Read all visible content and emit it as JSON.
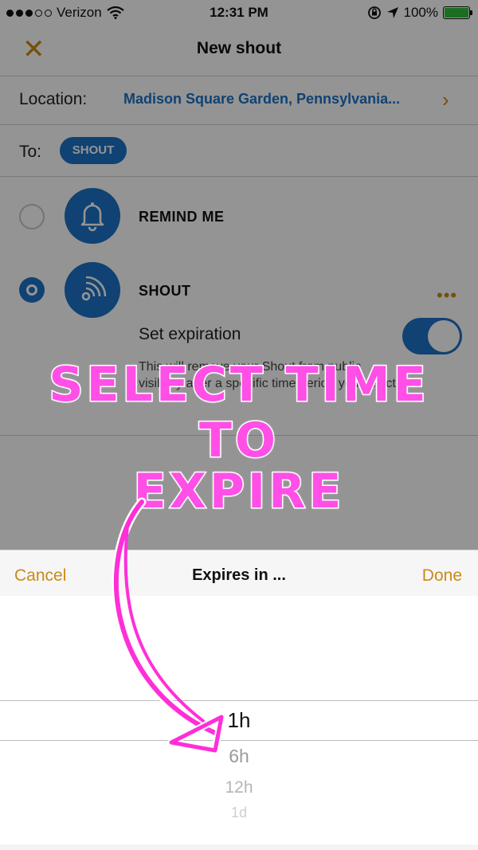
{
  "status_bar": {
    "carrier": "Verizon",
    "time": "12:31 PM",
    "battery": "100%"
  },
  "nav": {
    "title": "New shout"
  },
  "location": {
    "label": "Location:",
    "value": "Madison Square Garden, Pennsylvania..."
  },
  "to": {
    "label": "To:",
    "chip": "SHOUT"
  },
  "options": [
    {
      "title": "REMIND ME",
      "selected": false
    },
    {
      "title": "SHOUT",
      "selected": true
    }
  ],
  "more_label": "•••",
  "expiration": {
    "label": "Set expiration",
    "enabled": true,
    "description": "This will remove your Shout from public visibility after a specific time period you select."
  },
  "annotation": {
    "line1": "SELECT TIME TO",
    "line2": "EXPIRE"
  },
  "picker": {
    "cancel": "Cancel",
    "title": "Expires in ...",
    "done": "Done",
    "options": [
      "1h",
      "6h",
      "12h",
      "1d"
    ]
  },
  "colors": {
    "accent": "#c98a16",
    "brand": "#1d73c7",
    "annotation": "#ff4fe6"
  }
}
